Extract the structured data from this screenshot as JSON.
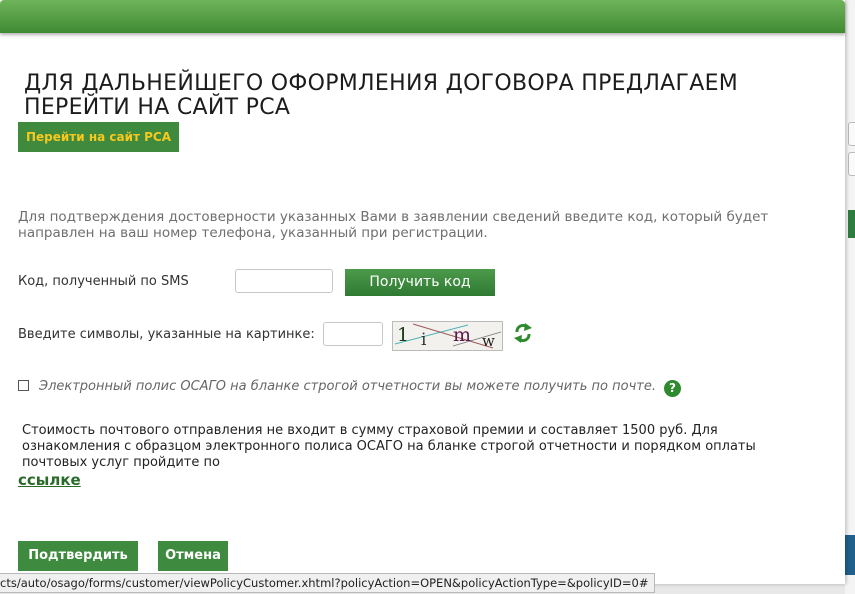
{
  "modal": {
    "title": "ДЛЯ ДАЛЬНЕЙШЕГО ОФОРМЛЕНИЯ ДОГОВОРА ПРЕДЛАГАЕМ ПЕРЕЙТИ НА САЙТ РСА",
    "rsa_button": "Перейти на сайт РСА",
    "confirm_text": "Для подтверждения достоверности указанных Вами в заявлении сведений введите код, который будет направлен на ваш номер телефона, указанный при регистрации.",
    "sms": {
      "label": "Код, полученный по SMS",
      "value": "",
      "button": "Получить код"
    },
    "captcha": {
      "label": "Введите символы, указанные на картинке:",
      "value": "",
      "image_chars": [
        "1",
        "i",
        "m",
        "w"
      ],
      "refresh_icon": "refresh-icon"
    },
    "paper_policy": {
      "checked": false,
      "text": "Электронный полис ОСАГО на бланке строгой отчетности вы можете получить по почте.",
      "help_icon": "?"
    },
    "postal_text": "Стоимость почтового отправления не входит в сумму страховой премии и составляет 1500 руб. Для ознакомления с образцом электронного полиса ОСАГО на бланке строгой отчетности и порядком оплаты почтовых услуг пройдите по",
    "link_text": "ссылке",
    "confirm_button": "Подтвердить",
    "cancel_button": "Отмена"
  },
  "status_bar": {
    "url": "cts/auto/osago/forms/customer/viewPolicyCustomer.xhtml?policyAction=OPEN&policyActionType=&policyID=0#"
  },
  "colors": {
    "header_green": "#4f9d44",
    "button_green": "#3e8a3e",
    "rsa_button_text": "#f7c81e",
    "link_green": "#2a6b2a"
  }
}
